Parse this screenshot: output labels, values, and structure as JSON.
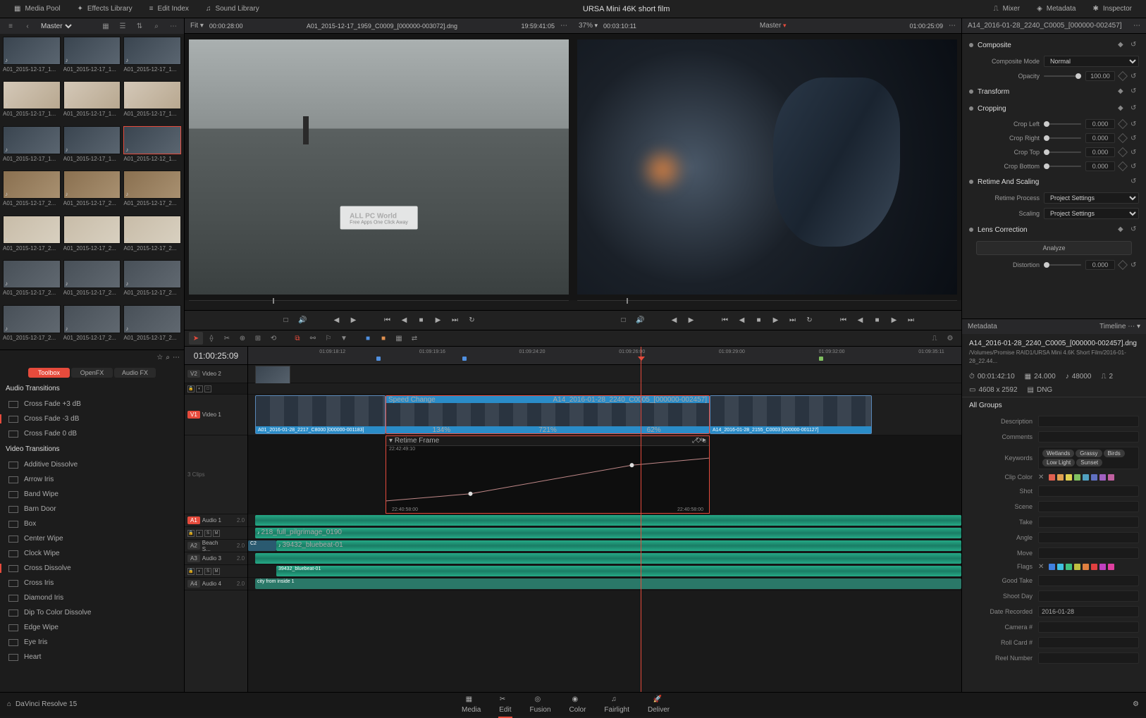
{
  "project_title": "URSA Mini 46K short film",
  "topbar": {
    "media_pool": "Media Pool",
    "effects_library": "Effects Library",
    "edit_index": "Edit Index",
    "sound_library": "Sound Library",
    "mixer": "Mixer",
    "metadata": "Metadata",
    "inspector": "Inspector"
  },
  "pool": {
    "bin": "Master",
    "clips": [
      "A01_2015-12-17_1...",
      "A01_2015-12-17_1...",
      "A01_2015-12-17_1...",
      "A01_2015-12-17_1...",
      "A01_2015-12-17_1...",
      "A01_2015-12-17_1...",
      "A01_2015-12-17_1...",
      "A01_2015-12-17_1...",
      "A01_2015-12-12_1...",
      "A01_2015-12-17_2...",
      "A01_2015-12-17_2...",
      "A01_2015-12-17_2...",
      "A01_2015-12-17_2...",
      "A01_2015-12-17_2...",
      "A01_2015-12-17_2...",
      "A01_2015-12-17_2...",
      "A01_2015-12-17_2...",
      "A01_2015-12-17_2...",
      "A01_2015-12-17_2...",
      "A01_2015-12-17_2...",
      "A01_2015-12-17_2..."
    ],
    "selected_index": 8
  },
  "fx": {
    "tabs": {
      "toolbox": "Toolbox",
      "openfx": "OpenFX",
      "audiofx": "Audio FX"
    },
    "audio_transitions_header": "Audio Transitions",
    "audio_transitions": [
      "Cross Fade +3 dB",
      "Cross Fade -3 dB",
      "Cross Fade 0 dB"
    ],
    "video_transitions_header": "Video Transitions",
    "video_transitions": [
      "Additive Dissolve",
      "Arrow Iris",
      "Band Wipe",
      "Barn Door",
      "Box",
      "Center Wipe",
      "Clock Wipe",
      "Cross Dissolve",
      "Cross Iris",
      "Diamond Iris",
      "Dip To Color Dissolve",
      "Edge Wipe",
      "Eye Iris",
      "Heart"
    ]
  },
  "viewer": {
    "fit": "Fit",
    "src_in": "00:00:28:00",
    "src_name": "A01_2015-12-17_1959_C0009_[000000-003072].dng",
    "src_tc": "19:59:41:05",
    "zoom": "37%",
    "rec_in": "00:03:10:11",
    "rec_master": "Master",
    "rec_tc": "01:00:25:09",
    "rec_name": "A14_2016-01-28_2240_C0005_[000000-002457]",
    "watermark": "ALL PC World",
    "watermark_sub": "Free Apps One Click Away"
  },
  "timeline": {
    "tc": "01:00:25:09",
    "ruler": [
      "01:09:18:12",
      "01:09:19:16",
      "01:09:24:20",
      "01:09:26:00",
      "01:09:29:00",
      "01:09:32:00",
      "01:09:35:11"
    ],
    "tracks": {
      "v2": {
        "tag": "V2",
        "name": "Video 2"
      },
      "v1": {
        "tag": "V1",
        "name": "Video 1",
        "sub": "3 Clips"
      },
      "a1": {
        "tag": "A1",
        "name": "Audio 1",
        "lvl": "2.0"
      },
      "a2": {
        "tag": "A2",
        "name": "Beach S...",
        "lvl": "2.0"
      },
      "a3": {
        "tag": "A3",
        "name": "Audio 3",
        "lvl": "2.0"
      },
      "a4": {
        "tag": "A4",
        "name": "Audio 4",
        "lvl": "2.0"
      }
    },
    "spd_label": "Speed Change",
    "spd_clip": "A14_2016-01-28_2240_C0005_[000000-002457]",
    "clip_a": "A01_2016-01-28_2217_C8000 [000000-001183]",
    "clip_c": "A14_2016-01-28_2155_C0003 [000000-001127]",
    "pct_a": "134%",
    "pct_b": "721%",
    "pct_c": "62%",
    "retime_label": "Retime Frame",
    "rt_tc1": "22:42:49:10",
    "rt_tc2": "22:40:58:00",
    "rt_tc3": "22:40:58:00",
    "audio1": "218_full_pilgrimage_0190",
    "audio2_pre": "C2",
    "audio2": "39432_bluebeat-01",
    "audio3": "39432_bluebeat-01",
    "audio4": "city from inside 1"
  },
  "inspector": {
    "clip_name": "A14_2016-01-28_2240_C0005_[000000-002457]",
    "composite": "Composite",
    "composite_mode_lbl": "Composite Mode",
    "composite_mode": "Normal",
    "opacity_lbl": "Opacity",
    "opacity": "100.00",
    "transform": "Transform",
    "cropping": "Cropping",
    "crop_left_lbl": "Crop Left",
    "crop_right_lbl": "Crop Right",
    "crop_top_lbl": "Crop Top",
    "crop_bottom_lbl": "Crop Bottom",
    "crop_val": "0.000",
    "retime_scaling": "Retime And Scaling",
    "retime_process_lbl": "Retime Process",
    "scaling_lbl": "Scaling",
    "project_settings": "Project Settings",
    "lens_correction": "Lens Correction",
    "analyze": "Analyze",
    "distortion_lbl": "Distortion",
    "distortion": "0.000"
  },
  "metadata": {
    "header": "Metadata",
    "mode": "Timeline",
    "filename": "A14_2016-01-28_2240_C0005_[000000-002457].dng",
    "path": "/Volumes/Promise RAID1/URSA Mini 4.6K Short Film/2016-01-28_22.44...",
    "duration": "00:01:42:10",
    "frames": "24.000",
    "rate": "48000",
    "ch": "2",
    "res": "4608 x 2592",
    "codec": "DNG",
    "all_groups": "All Groups",
    "fields": {
      "description": "Description",
      "comments": "Comments",
      "keywords": "Keywords",
      "clip_color": "Clip Color",
      "shot": "Shot",
      "scene": "Scene",
      "take": "Take",
      "angle": "Angle",
      "move": "Move",
      "flags": "Flags",
      "good_take": "Good Take",
      "shoot_day": "Shoot Day",
      "date_recorded": "Date Recorded",
      "camera": "Camera #",
      "roll_card": "Roll Card #",
      "reel_number": "Reel Number"
    },
    "keywords_tags": [
      "Wetlands",
      "Grassy",
      "Birds",
      "Low Light",
      "Sunset"
    ],
    "date_recorded": "2016-01-28",
    "clip_colors": [
      "#e06050",
      "#e0a050",
      "#e0d050",
      "#80c060",
      "#50a0c0",
      "#6070c0",
      "#a060c0",
      "#c060a0"
    ],
    "flag_colors": [
      "#4080e0",
      "#40c0e0",
      "#40c080",
      "#c0c040",
      "#e08040",
      "#e04040",
      "#c040c0",
      "#e040a0"
    ]
  },
  "pages": {
    "media": "Media",
    "edit": "Edit",
    "fusion": "Fusion",
    "color": "Color",
    "fairlight": "Fairlight",
    "deliver": "Deliver"
  },
  "app_name": "DaVinci Resolve 15"
}
